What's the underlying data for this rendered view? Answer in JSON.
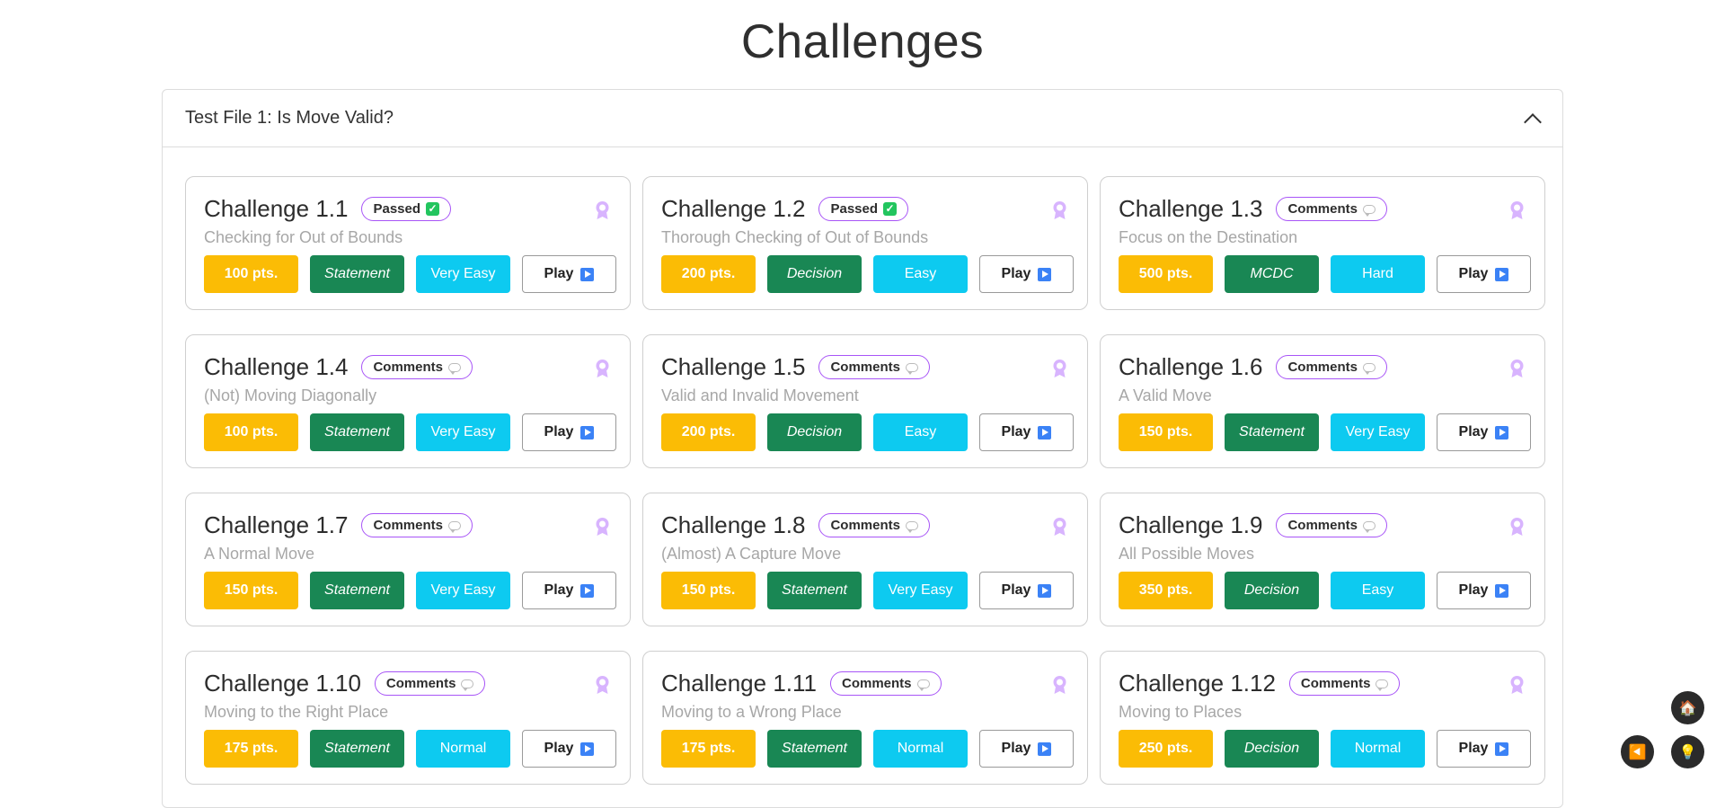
{
  "page": {
    "title": "Challenges"
  },
  "accordion": {
    "title": "Test File 1: Is Move Valid?"
  },
  "play_label": "Play",
  "colors": {
    "accent": "#a855f7",
    "points": "#fbbc05",
    "type": "#198754",
    "difficulty": "#0dcaf0"
  },
  "challenges": [
    {
      "title": "Challenge 1.1",
      "status": "Passed",
      "subtitle": "Checking for Out of Bounds",
      "points": "100 pts.",
      "coverage": "Statement",
      "difficulty": "Very Easy"
    },
    {
      "title": "Challenge 1.2",
      "status": "Passed",
      "subtitle": "Thorough Checking of Out of Bounds",
      "points": "200 pts.",
      "coverage": "Decision",
      "difficulty": "Easy"
    },
    {
      "title": "Challenge 1.3",
      "status": "Comments",
      "subtitle": "Focus on the Destination",
      "points": "500 pts.",
      "coverage": "MCDC",
      "difficulty": "Hard"
    },
    {
      "title": "Challenge 1.4",
      "status": "Comments",
      "subtitle": "(Not) Moving Diagonally",
      "points": "100 pts.",
      "coverage": "Statement",
      "difficulty": "Very Easy"
    },
    {
      "title": "Challenge 1.5",
      "status": "Comments",
      "subtitle": "Valid and Invalid Movement",
      "points": "200 pts.",
      "coverage": "Decision",
      "difficulty": "Easy"
    },
    {
      "title": "Challenge 1.6",
      "status": "Comments",
      "subtitle": "A Valid Move",
      "points": "150 pts.",
      "coverage": "Statement",
      "difficulty": "Very Easy"
    },
    {
      "title": "Challenge 1.7",
      "status": "Comments",
      "subtitle": "A Normal Move",
      "points": "150 pts.",
      "coverage": "Statement",
      "difficulty": "Very Easy"
    },
    {
      "title": "Challenge 1.8",
      "status": "Comments",
      "subtitle": "(Almost) A Capture Move",
      "points": "150 pts.",
      "coverage": "Statement",
      "difficulty": "Very Easy"
    },
    {
      "title": "Challenge 1.9",
      "status": "Comments",
      "subtitle": "All Possible Moves",
      "points": "350 pts.",
      "coverage": "Decision",
      "difficulty": "Easy"
    },
    {
      "title": "Challenge 1.10",
      "status": "Comments",
      "subtitle": "Moving to the Right Place",
      "points": "175 pts.",
      "coverage": "Statement",
      "difficulty": "Normal"
    },
    {
      "title": "Challenge 1.11",
      "status": "Comments",
      "subtitle": "Moving to a Wrong Place",
      "points": "175 pts.",
      "coverage": "Statement",
      "difficulty": "Normal"
    },
    {
      "title": "Challenge 1.12",
      "status": "Comments",
      "subtitle": "Moving to Places",
      "points": "250 pts.",
      "coverage": "Decision",
      "difficulty": "Normal"
    }
  ],
  "floating": {
    "home_icon": "house-icon",
    "back_icon": "back-arrow-icon",
    "hint_icon": "lightbulb-icon"
  }
}
